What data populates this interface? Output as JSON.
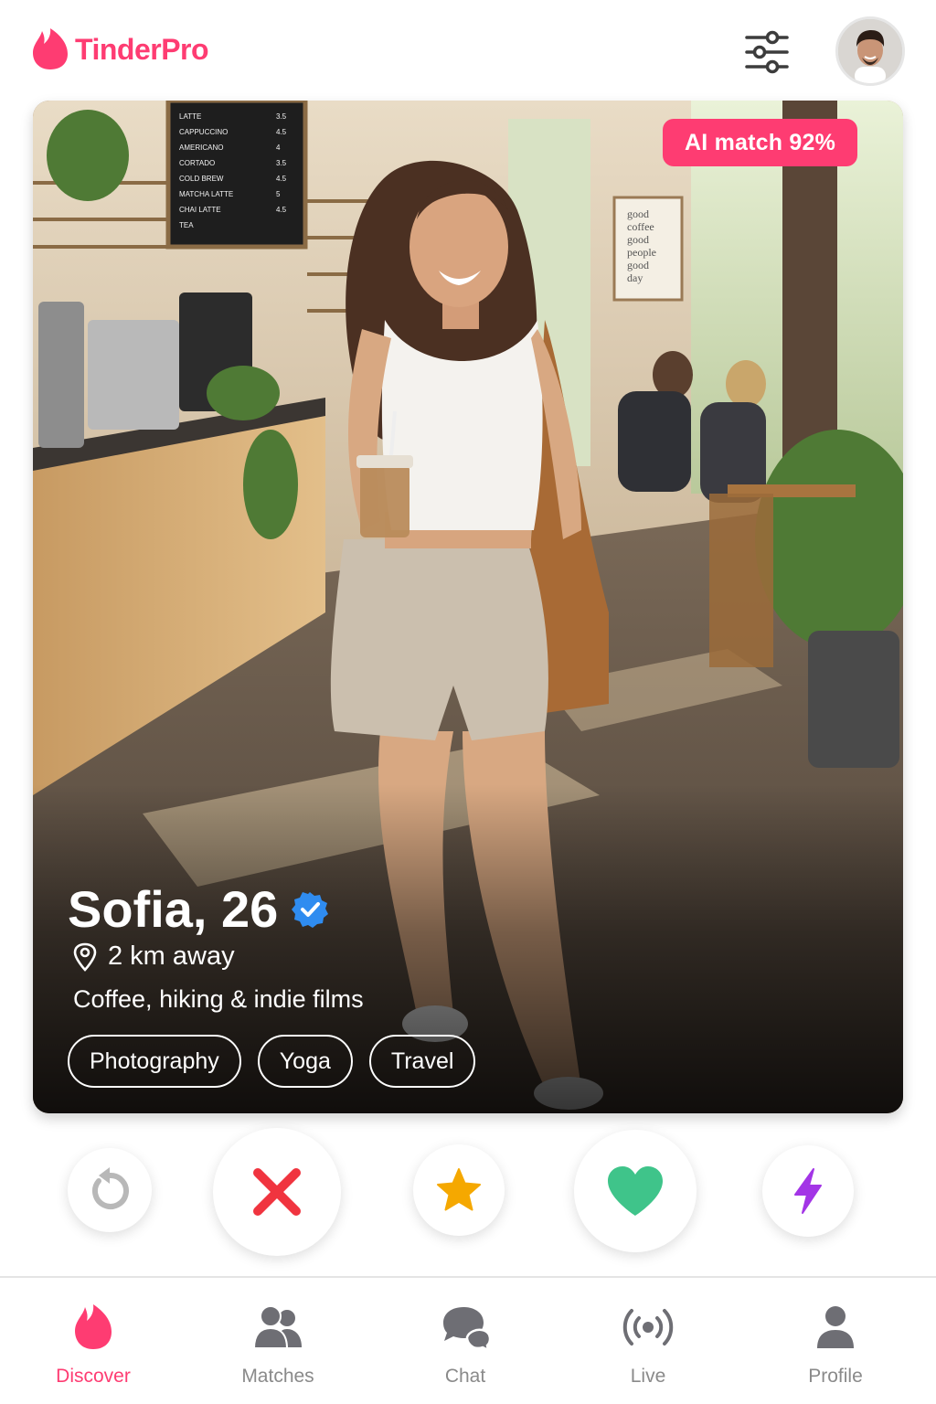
{
  "app": {
    "name": "TinderPro",
    "brand_color": "#fe3c72"
  },
  "header": {
    "filter_icon": "sliders-icon",
    "avatar_icon": "user-avatar"
  },
  "card": {
    "ai_match": "AI match 92%",
    "name_age": "Sofia, 26",
    "verified_icon": "verified-badge-icon",
    "distance": "2 km away",
    "bio": "Coffee, hiking & indie films",
    "tags": [
      "Photography",
      "Yoga",
      "Travel"
    ],
    "menu_board": [
      "LATTE",
      "CAPPUCCINO",
      "AMERICANO",
      "CORTADO",
      "COLD BREW",
      "MATCHA LATTE",
      "CHAI LATTE",
      "TEA"
    ],
    "menu_prices": [
      "3.5",
      "4.5",
      "4",
      "3.5",
      "4.5",
      "5",
      "4.5",
      ""
    ],
    "wall_sign": [
      "good",
      "coffee",
      "good",
      "people",
      "good",
      "day"
    ]
  },
  "actions": [
    {
      "name": "rewind",
      "icon": "rewind-icon",
      "color": "#b8b8b8"
    },
    {
      "name": "nope",
      "icon": "close-icon",
      "color": "#f0343f"
    },
    {
      "name": "super-like",
      "icon": "star-icon",
      "color": "#f5a800"
    },
    {
      "name": "like",
      "icon": "heart-icon",
      "color": "#3fc48a"
    },
    {
      "name": "boost",
      "icon": "lightning-icon",
      "color": "#a335e6"
    }
  ],
  "nav": {
    "active": "Discover",
    "items": [
      {
        "label": "Discover",
        "icon": "flame-icon"
      },
      {
        "label": "Matches",
        "icon": "people-icon"
      },
      {
        "label": "Chat",
        "icon": "chat-bubbles-icon"
      },
      {
        "label": "Live",
        "icon": "broadcast-icon"
      },
      {
        "label": "Profile",
        "icon": "person-icon"
      }
    ]
  }
}
